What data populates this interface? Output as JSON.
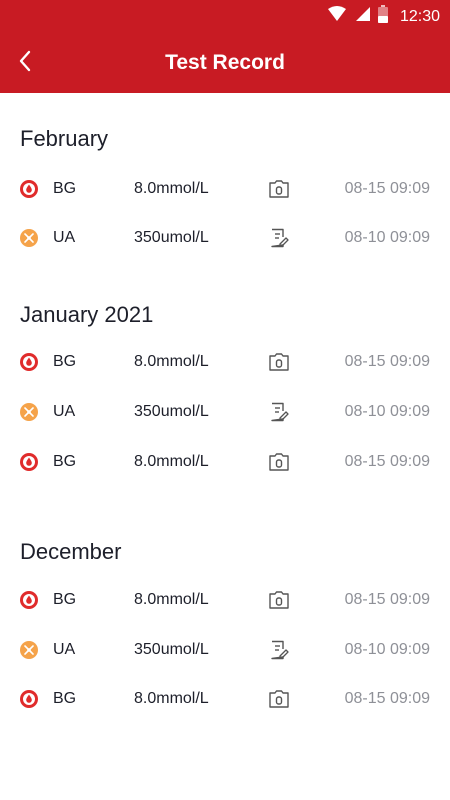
{
  "status_bar": {
    "time": "12:30"
  },
  "app_bar": {
    "title": "Test Record"
  },
  "sections": [
    {
      "month": "February",
      "rows": [
        {
          "kind": "BG",
          "value": "8.0mmol/L",
          "time": "08-15 09:09",
          "icon": "blood-drop-icon",
          "record": "camera-icon"
        },
        {
          "kind": "UA",
          "value": "350umol/L",
          "time": "08-10 09:09",
          "icon": "uric-acid-icon",
          "record": "note-edit-icon"
        }
      ]
    },
    {
      "month": "January 2021",
      "rows": [
        {
          "kind": "BG",
          "value": "8.0mmol/L",
          "time": "08-15 09:09",
          "icon": "blood-drop-icon",
          "record": "camera-icon"
        },
        {
          "kind": "UA",
          "value": "350umol/L",
          "time": "08-10 09:09",
          "icon": "uric-acid-icon",
          "record": "note-edit-icon"
        },
        {
          "kind": "BG",
          "value": "8.0mmol/L",
          "time": "08-15 09:09",
          "icon": "blood-drop-icon",
          "record": "camera-icon"
        }
      ]
    },
    {
      "month": "December",
      "rows": [
        {
          "kind": "BG",
          "value": "8.0mmol/L",
          "time": "08-15 09:09",
          "icon": "blood-drop-icon",
          "record": "camera-icon"
        },
        {
          "kind": "UA",
          "value": "350umol/L",
          "time": "08-10 09:09",
          "icon": "uric-acid-icon",
          "record": "note-edit-icon"
        },
        {
          "kind": "BG",
          "value": "8.0mmol/L",
          "time": "08-15 09:09",
          "icon": "blood-drop-icon",
          "record": "camera-icon"
        }
      ]
    }
  ],
  "colors": {
    "brand_red": "#c81b23",
    "bg_icon": "#e02b2b",
    "ua_icon": "#f5a34a",
    "text": "#1d1f2a",
    "muted": "#8e9097"
  }
}
